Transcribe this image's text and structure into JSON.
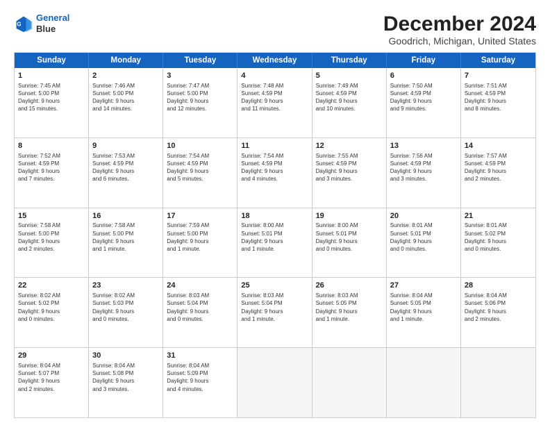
{
  "logo": {
    "line1": "General",
    "line2": "Blue"
  },
  "title": "December 2024",
  "subtitle": "Goodrich, Michigan, United States",
  "header_days": [
    "Sunday",
    "Monday",
    "Tuesday",
    "Wednesday",
    "Thursday",
    "Friday",
    "Saturday"
  ],
  "weeks": [
    [
      {
        "day": "1",
        "info": "Sunrise: 7:45 AM\nSunset: 5:00 PM\nDaylight: 9 hours\nand 15 minutes."
      },
      {
        "day": "2",
        "info": "Sunrise: 7:46 AM\nSunset: 5:00 PM\nDaylight: 9 hours\nand 14 minutes."
      },
      {
        "day": "3",
        "info": "Sunrise: 7:47 AM\nSunset: 5:00 PM\nDaylight: 9 hours\nand 12 minutes."
      },
      {
        "day": "4",
        "info": "Sunrise: 7:48 AM\nSunset: 4:59 PM\nDaylight: 9 hours\nand 11 minutes."
      },
      {
        "day": "5",
        "info": "Sunrise: 7:49 AM\nSunset: 4:59 PM\nDaylight: 9 hours\nand 10 minutes."
      },
      {
        "day": "6",
        "info": "Sunrise: 7:50 AM\nSunset: 4:59 PM\nDaylight: 9 hours\nand 9 minutes."
      },
      {
        "day": "7",
        "info": "Sunrise: 7:51 AM\nSunset: 4:59 PM\nDaylight: 9 hours\nand 8 minutes."
      }
    ],
    [
      {
        "day": "8",
        "info": "Sunrise: 7:52 AM\nSunset: 4:59 PM\nDaylight: 9 hours\nand 7 minutes."
      },
      {
        "day": "9",
        "info": "Sunrise: 7:53 AM\nSunset: 4:59 PM\nDaylight: 9 hours\nand 6 minutes."
      },
      {
        "day": "10",
        "info": "Sunrise: 7:54 AM\nSunset: 4:59 PM\nDaylight: 9 hours\nand 5 minutes."
      },
      {
        "day": "11",
        "info": "Sunrise: 7:54 AM\nSunset: 4:59 PM\nDaylight: 9 hours\nand 4 minutes."
      },
      {
        "day": "12",
        "info": "Sunrise: 7:55 AM\nSunset: 4:59 PM\nDaylight: 9 hours\nand 3 minutes."
      },
      {
        "day": "13",
        "info": "Sunrise: 7:56 AM\nSunset: 4:59 PM\nDaylight: 9 hours\nand 3 minutes."
      },
      {
        "day": "14",
        "info": "Sunrise: 7:57 AM\nSunset: 4:59 PM\nDaylight: 9 hours\nand 2 minutes."
      }
    ],
    [
      {
        "day": "15",
        "info": "Sunrise: 7:58 AM\nSunset: 5:00 PM\nDaylight: 9 hours\nand 2 minutes."
      },
      {
        "day": "16",
        "info": "Sunrise: 7:58 AM\nSunset: 5:00 PM\nDaylight: 9 hours\nand 1 minute."
      },
      {
        "day": "17",
        "info": "Sunrise: 7:59 AM\nSunset: 5:00 PM\nDaylight: 9 hours\nand 1 minute."
      },
      {
        "day": "18",
        "info": "Sunrise: 8:00 AM\nSunset: 5:01 PM\nDaylight: 9 hours\nand 1 minute."
      },
      {
        "day": "19",
        "info": "Sunrise: 8:00 AM\nSunset: 5:01 PM\nDaylight: 9 hours\nand 0 minutes."
      },
      {
        "day": "20",
        "info": "Sunrise: 8:01 AM\nSunset: 5:01 PM\nDaylight: 9 hours\nand 0 minutes."
      },
      {
        "day": "21",
        "info": "Sunrise: 8:01 AM\nSunset: 5:02 PM\nDaylight: 9 hours\nand 0 minutes."
      }
    ],
    [
      {
        "day": "22",
        "info": "Sunrise: 8:02 AM\nSunset: 5:02 PM\nDaylight: 9 hours\nand 0 minutes."
      },
      {
        "day": "23",
        "info": "Sunrise: 8:02 AM\nSunset: 5:03 PM\nDaylight: 9 hours\nand 0 minutes."
      },
      {
        "day": "24",
        "info": "Sunrise: 8:03 AM\nSunset: 5:04 PM\nDaylight: 9 hours\nand 0 minutes."
      },
      {
        "day": "25",
        "info": "Sunrise: 8:03 AM\nSunset: 5:04 PM\nDaylight: 9 hours\nand 1 minute."
      },
      {
        "day": "26",
        "info": "Sunrise: 8:03 AM\nSunset: 5:05 PM\nDaylight: 9 hours\nand 1 minute."
      },
      {
        "day": "27",
        "info": "Sunrise: 8:04 AM\nSunset: 5:05 PM\nDaylight: 9 hours\nand 1 minute."
      },
      {
        "day": "28",
        "info": "Sunrise: 8:04 AM\nSunset: 5:06 PM\nDaylight: 9 hours\nand 2 minutes."
      }
    ],
    [
      {
        "day": "29",
        "info": "Sunrise: 8:04 AM\nSunset: 5:07 PM\nDaylight: 9 hours\nand 2 minutes."
      },
      {
        "day": "30",
        "info": "Sunrise: 8:04 AM\nSunset: 5:08 PM\nDaylight: 9 hours\nand 3 minutes."
      },
      {
        "day": "31",
        "info": "Sunrise: 8:04 AM\nSunset: 5:09 PM\nDaylight: 9 hours\nand 4 minutes."
      },
      {
        "day": "",
        "info": ""
      },
      {
        "day": "",
        "info": ""
      },
      {
        "day": "",
        "info": ""
      },
      {
        "day": "",
        "info": ""
      }
    ]
  ]
}
